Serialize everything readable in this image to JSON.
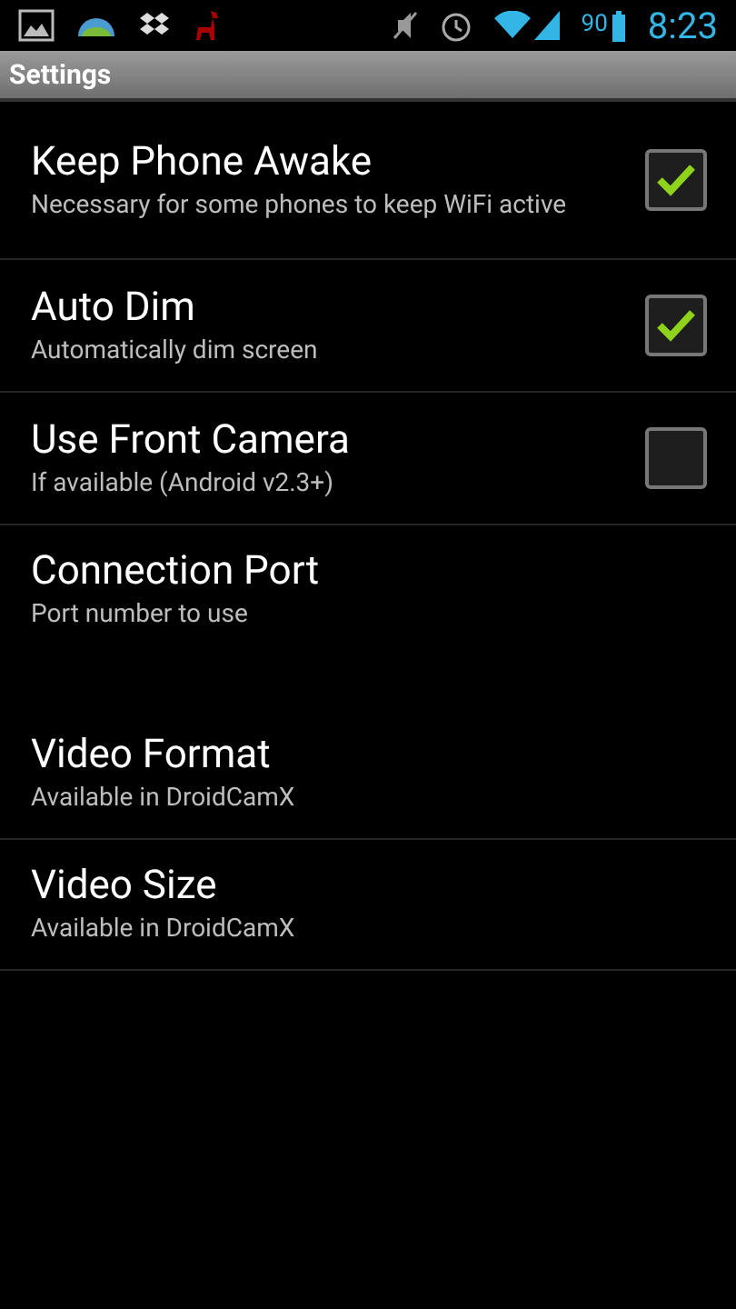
{
  "status_bar": {
    "battery_percent": "90",
    "time": "8:23"
  },
  "title": "Settings",
  "items": [
    {
      "kind": "checkbox",
      "title": "Keep Phone Awake",
      "summary": "Necessary for some phones to keep WiFi active",
      "checked": true
    },
    {
      "kind": "checkbox",
      "title": "Auto Dim",
      "summary": "Automatically dim screen",
      "checked": true
    },
    {
      "kind": "checkbox",
      "title": "Use Front Camera",
      "summary": "If available (Android v2.3+)",
      "checked": false
    },
    {
      "kind": "edit",
      "title": "Connection Port",
      "summary": "Port number to use"
    },
    {
      "kind": "plain",
      "title": "Video Format",
      "summary": "Available in DroidCamX"
    },
    {
      "kind": "plain",
      "title": "Video Size",
      "summary": "Available in DroidCamX"
    }
  ]
}
